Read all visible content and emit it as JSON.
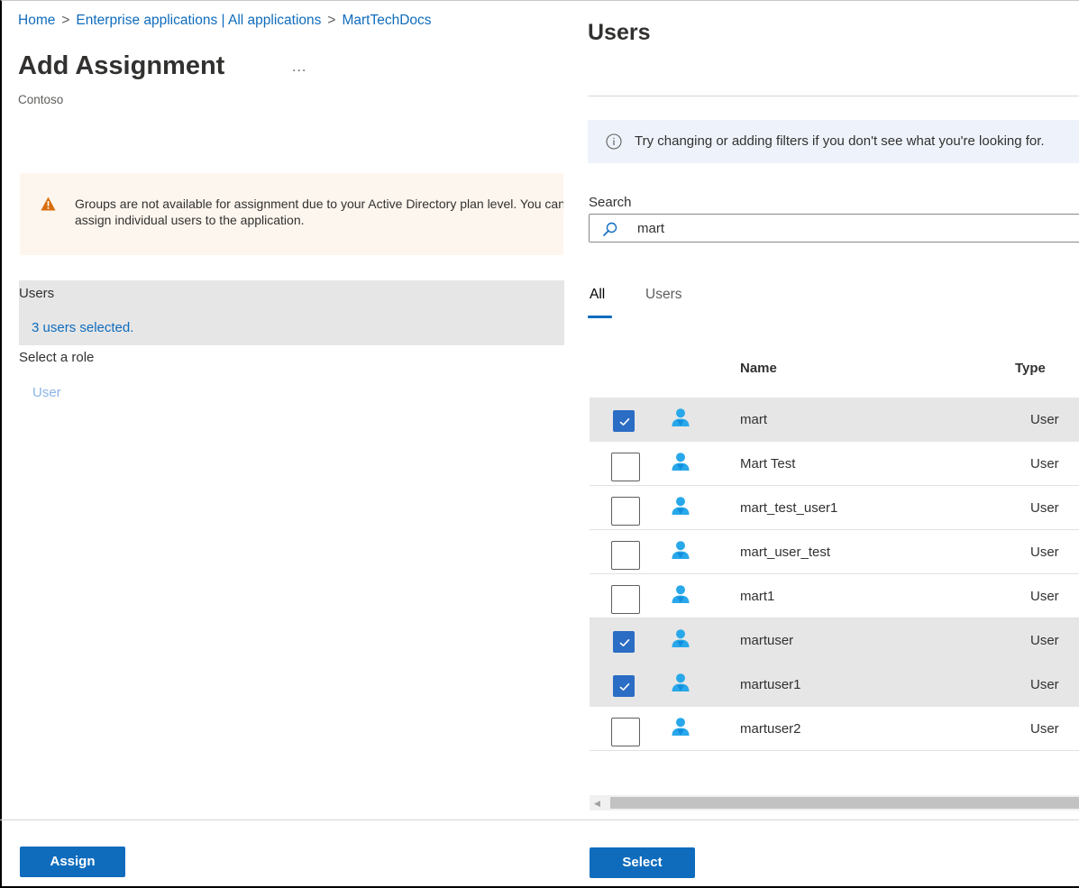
{
  "breadcrumb": {
    "items": [
      "Home",
      "Enterprise applications | All applications",
      "MartTechDocs"
    ],
    "separator": ">"
  },
  "assignment": {
    "title": "Add Assignment",
    "more_label": "...",
    "subtitle": "Contoso",
    "warning_text": "Groups are not available for assignment due to your Active Directory plan level. You can assign individual users to the application.",
    "users_label": "Users",
    "users_selected": "3 users selected.",
    "role_label": "Select a role",
    "role_value": "User",
    "assign_button": "Assign"
  },
  "users_panel": {
    "title": "Users",
    "info_text": "Try changing or adding filters if you don't see what you're looking for.",
    "search_label": "Search",
    "search_value": "mart",
    "tabs": [
      {
        "label": "All",
        "active": true
      },
      {
        "label": "Users",
        "active": false
      }
    ],
    "columns": {
      "name": "Name",
      "type": "Type"
    },
    "rows": [
      {
        "name": "mart",
        "type": "User",
        "checked": true
      },
      {
        "name": "Mart Test",
        "type": "User",
        "checked": false
      },
      {
        "name": "mart_test_user1",
        "type": "User",
        "checked": false
      },
      {
        "name": "mart_user_test",
        "type": "User",
        "checked": false
      },
      {
        "name": "mart1",
        "type": "User",
        "checked": false
      },
      {
        "name": "martuser",
        "type": "User",
        "checked": true
      },
      {
        "name": "martuser1",
        "type": "User",
        "checked": true
      },
      {
        "name": "martuser2",
        "type": "User",
        "checked": false
      }
    ],
    "select_button": "Select"
  },
  "icons": {
    "warning": "warning-triangle-icon",
    "info": "info-icon",
    "search": "search-icon",
    "user": "user-icon",
    "check": "checkmark-icon",
    "scroll_left": "scroll-left-arrow-icon"
  },
  "colors": {
    "accent": "#0f6cbd",
    "checkbox_checked": "#2b6cc4",
    "warning_bg": "#fdf6ee",
    "warning_icon": "#d86f0e",
    "info_bg": "#eef3fb",
    "selected_row": "#e6e6e6",
    "avatar": "#28a8ea"
  }
}
